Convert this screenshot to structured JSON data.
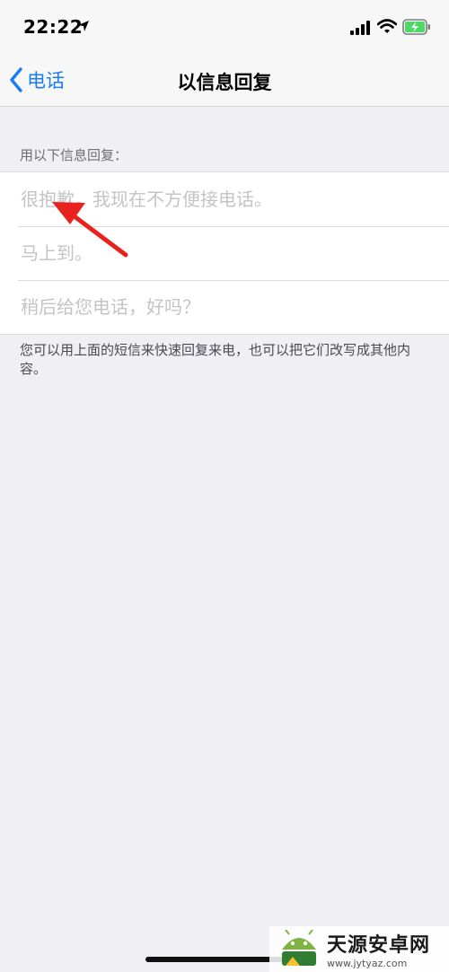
{
  "status_bar": {
    "time": "22:22",
    "icons": [
      "location-arrow-icon",
      "cellular-signal-icon",
      "wifi-icon",
      "battery-charging-icon"
    ],
    "battery_color": "#4cd964"
  },
  "nav": {
    "back_label": "电话",
    "title": "以信息回复",
    "accent_color": "#1a7cf5"
  },
  "section": {
    "header": "用以下信息回复：",
    "replies": [
      {
        "value": "",
        "placeholder": "很抱歉，我现在不方便接电话。"
      },
      {
        "value": "",
        "placeholder": "马上到。"
      },
      {
        "value": "",
        "placeholder": "稍后给您电话，好吗？"
      }
    ],
    "footer": "您可以用上面的短信来快速回复来电，也可以把它们改写成其他内容。"
  },
  "annotation": {
    "type": "arrow",
    "color": "#e8231f"
  },
  "watermark": {
    "title": "天源安卓网",
    "url": "www.jytyaz.com"
  }
}
